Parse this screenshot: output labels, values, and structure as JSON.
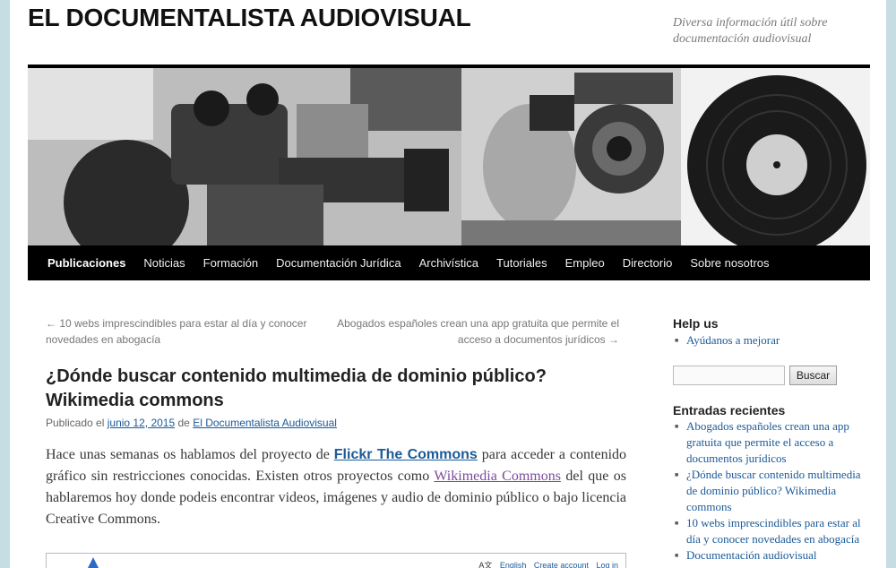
{
  "header": {
    "site_title": "EL DOCUMENTALISTA AUDIOVISUAL",
    "site_description": "Diversa información útil sobre documentación audiovisual"
  },
  "nav": {
    "items": [
      "Publicaciones",
      "Noticias",
      "Formación",
      "Documentación Jurídica",
      "Archivística",
      "Tutoriales",
      "Empleo",
      "Directorio",
      "Sobre nosotros"
    ]
  },
  "post_nav": {
    "prev": "← 10 webs imprescindibles para estar al día y conocer novedades en abogacía",
    "next": "Abogados españoles crean una app gratuita que permite el acceso a documentos jurídicos →"
  },
  "article": {
    "title": "¿Dónde buscar contenido multimedia de dominio público? Wikimedia commons",
    "meta_prefix": "Publicado el",
    "meta_date": "junio 12, 2015",
    "meta_by": "de",
    "meta_author": "El Documentalista Audiovisual",
    "p1_a": "Hace unas semanas os hablamos del proyecto de ",
    "p1_link1": "Flickr The Commons",
    "p1_b": " para acceder a contenido gráfico sin restricciones conocidas. Existen otros proyectos como ",
    "p1_link2": "Wikimedia Commons",
    "p1_c": " del que os hablaremos hoy donde podeis encontrar videos, imágenes y audio de dominio público o bajo licencia Creative Commons."
  },
  "embedded_shot": {
    "lang_icon": "A文",
    "links": [
      "English",
      "Create account",
      "Log in"
    ]
  },
  "sidebar": {
    "help_title": "Help us",
    "help_items": [
      "Ayúdanos a mejorar"
    ],
    "search_button": "Buscar",
    "recent_title": "Entradas recientes",
    "recent_items": [
      "Abogados españoles crean una app gratuita que permite el acceso a documentos jurídicos",
      "¿Dónde buscar contenido multimedia de dominio público? Wikimedia commons",
      "10 webs imprescindibles para estar al día y conocer novedades en abogacía",
      "Documentación audiovisual"
    ]
  },
  "colors": {
    "link": "#1b5a98",
    "visited": "#7d4a9a",
    "nav_bg": "#000000",
    "page_bg": "#c5dde3"
  }
}
